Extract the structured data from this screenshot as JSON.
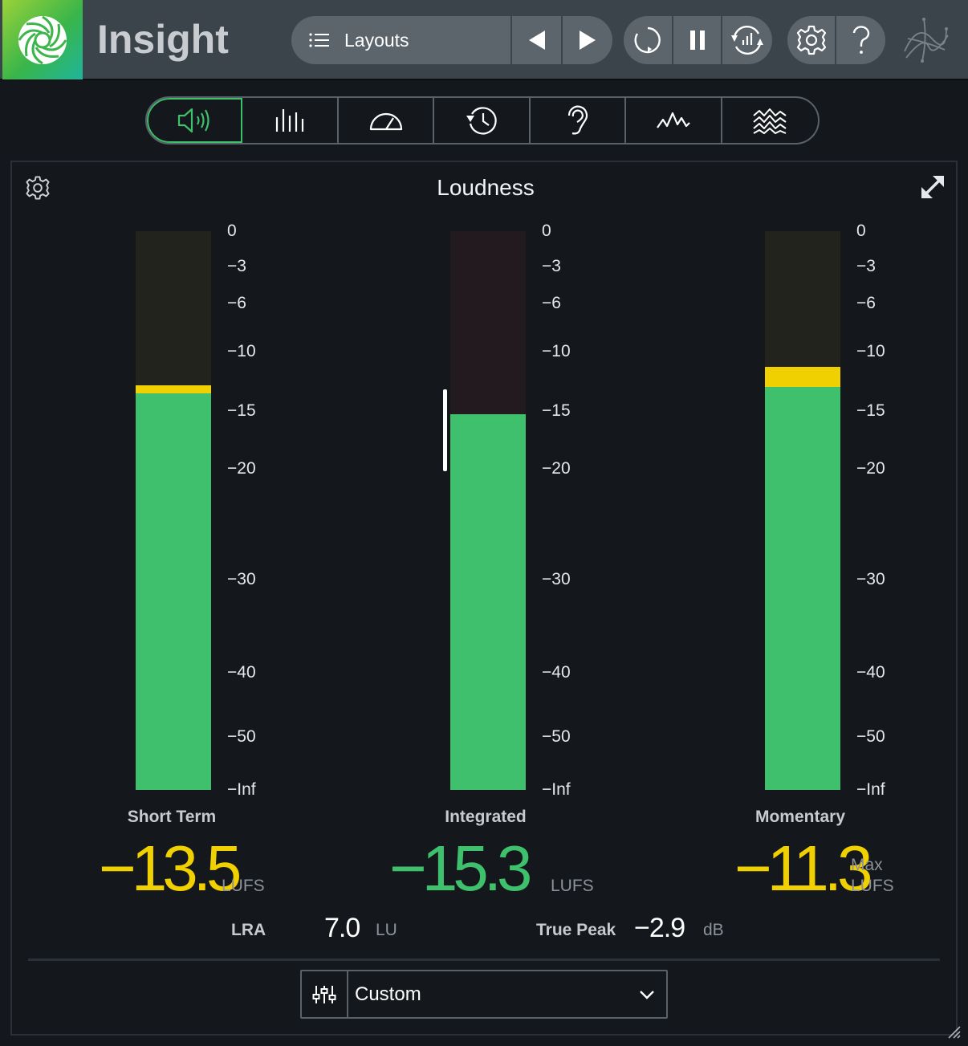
{
  "header": {
    "app_title": "Insight",
    "logo_icon": "spiral-logo-icon",
    "layouts_label": "Layouts",
    "icons": {
      "menu": "list-icon",
      "prev": "play-left-icon",
      "next": "play-right-icon",
      "reset": "reset-icon",
      "pause": "pause-icon",
      "sync": "sync-icon",
      "settings": "gear-icon",
      "help": "help-icon",
      "brand": "izotope-mark-icon"
    }
  },
  "tabs": [
    {
      "name": "loudness",
      "icon": "speaker-icon",
      "active": true
    },
    {
      "name": "levels",
      "icon": "levels-bars-icon",
      "active": false
    },
    {
      "name": "stereo",
      "icon": "gauge-icon",
      "active": false
    },
    {
      "name": "history",
      "icon": "history-icon",
      "active": false
    },
    {
      "name": "intelligibility",
      "icon": "ear-icon",
      "active": false
    },
    {
      "name": "spectrum",
      "icon": "waveform-icon",
      "active": false
    },
    {
      "name": "spectrogram",
      "icon": "spectrogram-icon",
      "active": false
    }
  ],
  "panel": {
    "title": "Loudness",
    "scale_ticks": [
      "0",
      "−3",
      "−6",
      "−10",
      "−15",
      "−20",
      "−30",
      "−40",
      "−50",
      "−Inf"
    ],
    "meters": {
      "short_term": {
        "label": "Short Term",
        "value": "−13.5",
        "unit": "LUFS",
        "level_lufs": -13.5,
        "peak_hold_lufs": -13.0
      },
      "integrated": {
        "label": "Integrated",
        "value": "−15.3",
        "unit": "LUFS",
        "level_lufs": -15.3
      },
      "momentary": {
        "label": "Momentary",
        "value": "−11.3",
        "unit_line1": "Max",
        "unit_line2": "LUFS",
        "level_lufs": -13.0,
        "peak_hold_lufs": -11.3
      }
    },
    "stats": {
      "lra_label": "LRA",
      "lra_value": "7.0",
      "lra_unit": "LU",
      "true_peak_label": "True Peak",
      "true_peak_value": "−2.9",
      "true_peak_unit": "dB"
    },
    "preset": {
      "name": "Custom",
      "icon": "sliders-icon",
      "dropdown_icon": "chevron-down-icon"
    }
  },
  "colors": {
    "accent_green": "#3ec06d",
    "peak_yellow": "#f0d000",
    "header_bg": "#3b434b",
    "panel_bg": "#14171b"
  }
}
